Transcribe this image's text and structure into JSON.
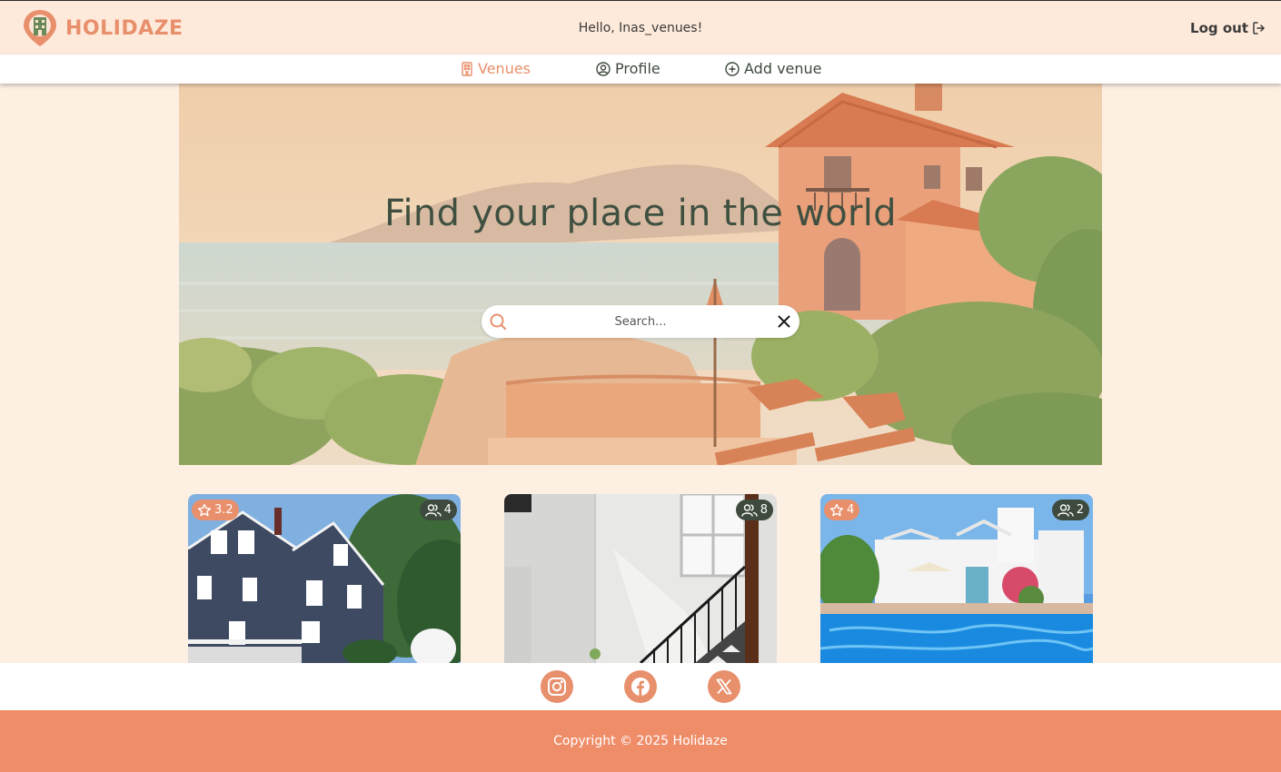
{
  "header": {
    "logo_text": "HOLIDAZE",
    "greeting": "Hello, Inas_venues!",
    "logout_label": "Log out"
  },
  "nav": {
    "items": [
      {
        "label": "Venues",
        "icon": "building-icon",
        "active": true
      },
      {
        "label": "Profile",
        "icon": "user-circle-icon",
        "active": false
      },
      {
        "label": "Add venue",
        "icon": "plus-circle-icon",
        "active": false
      }
    ]
  },
  "hero": {
    "title": "Find your place in the world",
    "search_placeholder": "Search...",
    "search_value": ""
  },
  "venues": [
    {
      "rating": "3.2",
      "guests": "4",
      "image": "blue-colonial-house"
    },
    {
      "rating": "",
      "guests": "8",
      "image": "white-interior-staircase"
    },
    {
      "rating": "4",
      "guests": "2",
      "image": "white-villa-with-pool"
    }
  ],
  "social": {
    "items": [
      "instagram-icon",
      "facebook-icon",
      "x-icon"
    ]
  },
  "footer": {
    "copyright": "Copyright © 2025 Holidaze"
  },
  "colors": {
    "accent": "#e88f6c",
    "dark_green": "#3d4a3d",
    "background": "#feefe3",
    "footer": "#ef8d69"
  }
}
